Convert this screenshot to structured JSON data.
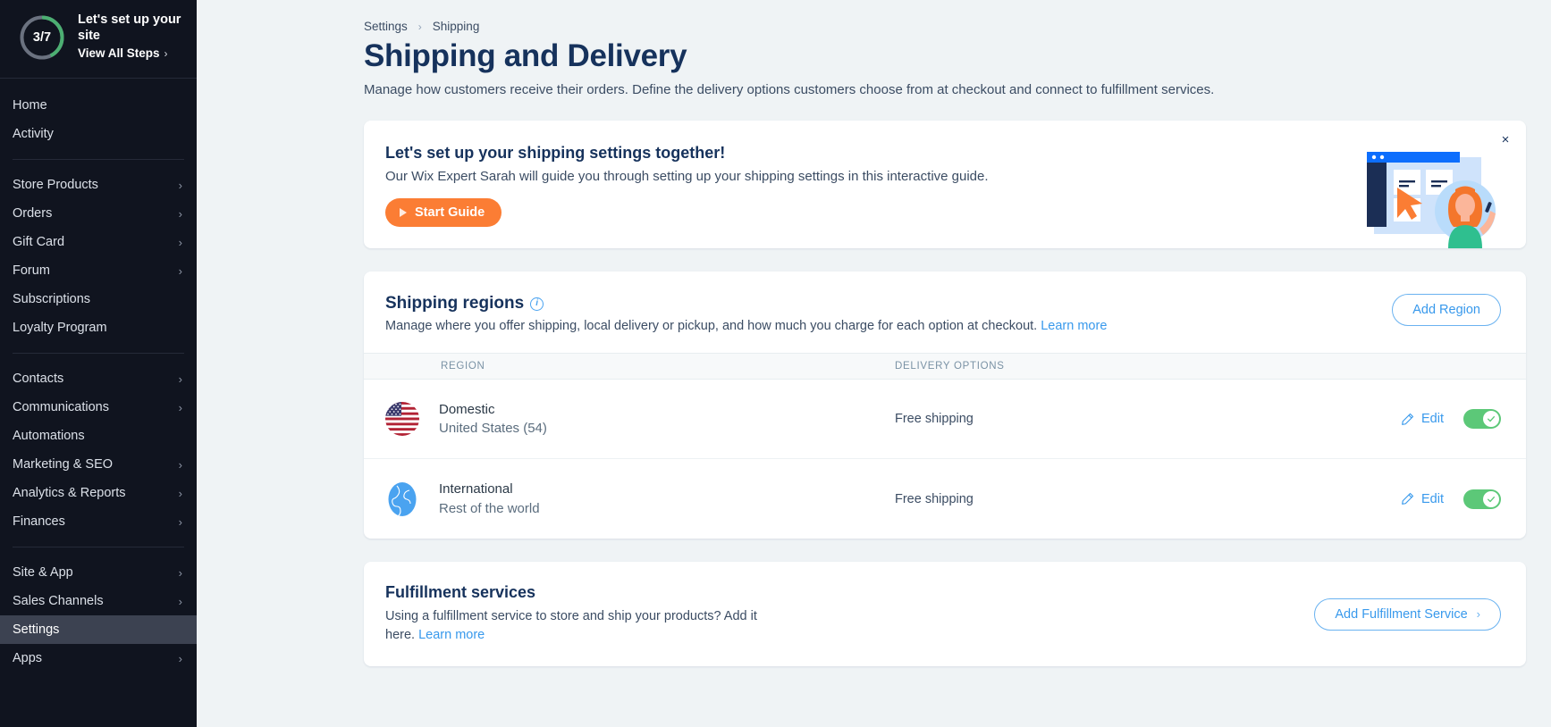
{
  "sidebar": {
    "setup": {
      "progress_label": "3/7",
      "progress_value": 3,
      "progress_total": 7,
      "title": "Let's set up your site",
      "link_label": "View All Steps",
      "ring_color": "#4caf72",
      "ring_track_color": "#6b7280"
    },
    "groups": [
      {
        "items": [
          {
            "label": "Home",
            "arrow": false,
            "active": false
          },
          {
            "label": "Activity",
            "arrow": false,
            "active": false
          }
        ]
      },
      {
        "items": [
          {
            "label": "Store Products",
            "arrow": true,
            "active": false
          },
          {
            "label": "Orders",
            "arrow": true,
            "active": false
          },
          {
            "label": "Gift Card",
            "arrow": true,
            "active": false
          },
          {
            "label": "Forum",
            "arrow": true,
            "active": false
          },
          {
            "label": "Subscriptions",
            "arrow": false,
            "active": false
          },
          {
            "label": "Loyalty Program",
            "arrow": false,
            "active": false
          }
        ]
      },
      {
        "items": [
          {
            "label": "Contacts",
            "arrow": true,
            "active": false
          },
          {
            "label": "Communications",
            "arrow": true,
            "active": false
          },
          {
            "label": "Automations",
            "arrow": false,
            "active": false
          },
          {
            "label": "Marketing & SEO",
            "arrow": true,
            "active": false
          },
          {
            "label": "Analytics & Reports",
            "arrow": true,
            "active": false
          },
          {
            "label": "Finances",
            "arrow": true,
            "active": false
          }
        ]
      },
      {
        "items": [
          {
            "label": "Site & App",
            "arrow": true,
            "active": false
          },
          {
            "label": "Sales Channels",
            "arrow": true,
            "active": false
          },
          {
            "label": "Settings",
            "arrow": false,
            "active": true
          },
          {
            "label": "Apps",
            "arrow": true,
            "active": false
          }
        ]
      }
    ]
  },
  "header": {
    "breadcrumb": [
      "Settings",
      "Shipping"
    ],
    "breadcrumb_separator": "›",
    "title": "Shipping and Delivery",
    "subtitle": "Manage how customers receive their orders. Define the delivery options customers choose from at checkout and connect to fulfillment services."
  },
  "promo": {
    "title": "Let's set up your shipping settings together!",
    "description": "Our Wix Expert Sarah will guide you through setting up your shipping settings in this interactive guide.",
    "button_label": "Start Guide",
    "button_color": "#fb7d34",
    "close_label": "×"
  },
  "regions": {
    "title": "Shipping regions",
    "description_before_link": "Manage where you offer shipping, local delivery or pickup, and how much you charge for each option at checkout. ",
    "learn_more": "Learn more",
    "add_button_label": "Add Region",
    "columns": {
      "region": "REGION",
      "delivery_options": "DELIVERY OPTIONS"
    },
    "rows": [
      {
        "icon": "us-flag-icon",
        "name": "Domestic",
        "sub": "United States (54)",
        "delivery": "Free shipping",
        "edit_label": "Edit",
        "enabled": true
      },
      {
        "icon": "globe-icon",
        "name": "International",
        "sub": "Rest of the world",
        "delivery": "Free shipping",
        "edit_label": "Edit",
        "enabled": true
      }
    ]
  },
  "fulfillment": {
    "title": "Fulfillment services",
    "description_before_link": "Using a fulfillment service to store and ship your products? Add it here. ",
    "learn_more": "Learn more",
    "button_label": "Add Fulfillment Service",
    "button_chevron": "›"
  },
  "colors": {
    "accent_blue": "#3899ec",
    "dark_navy": "#16325c",
    "toggle_green": "#5cc878",
    "orange": "#fb7d34"
  }
}
